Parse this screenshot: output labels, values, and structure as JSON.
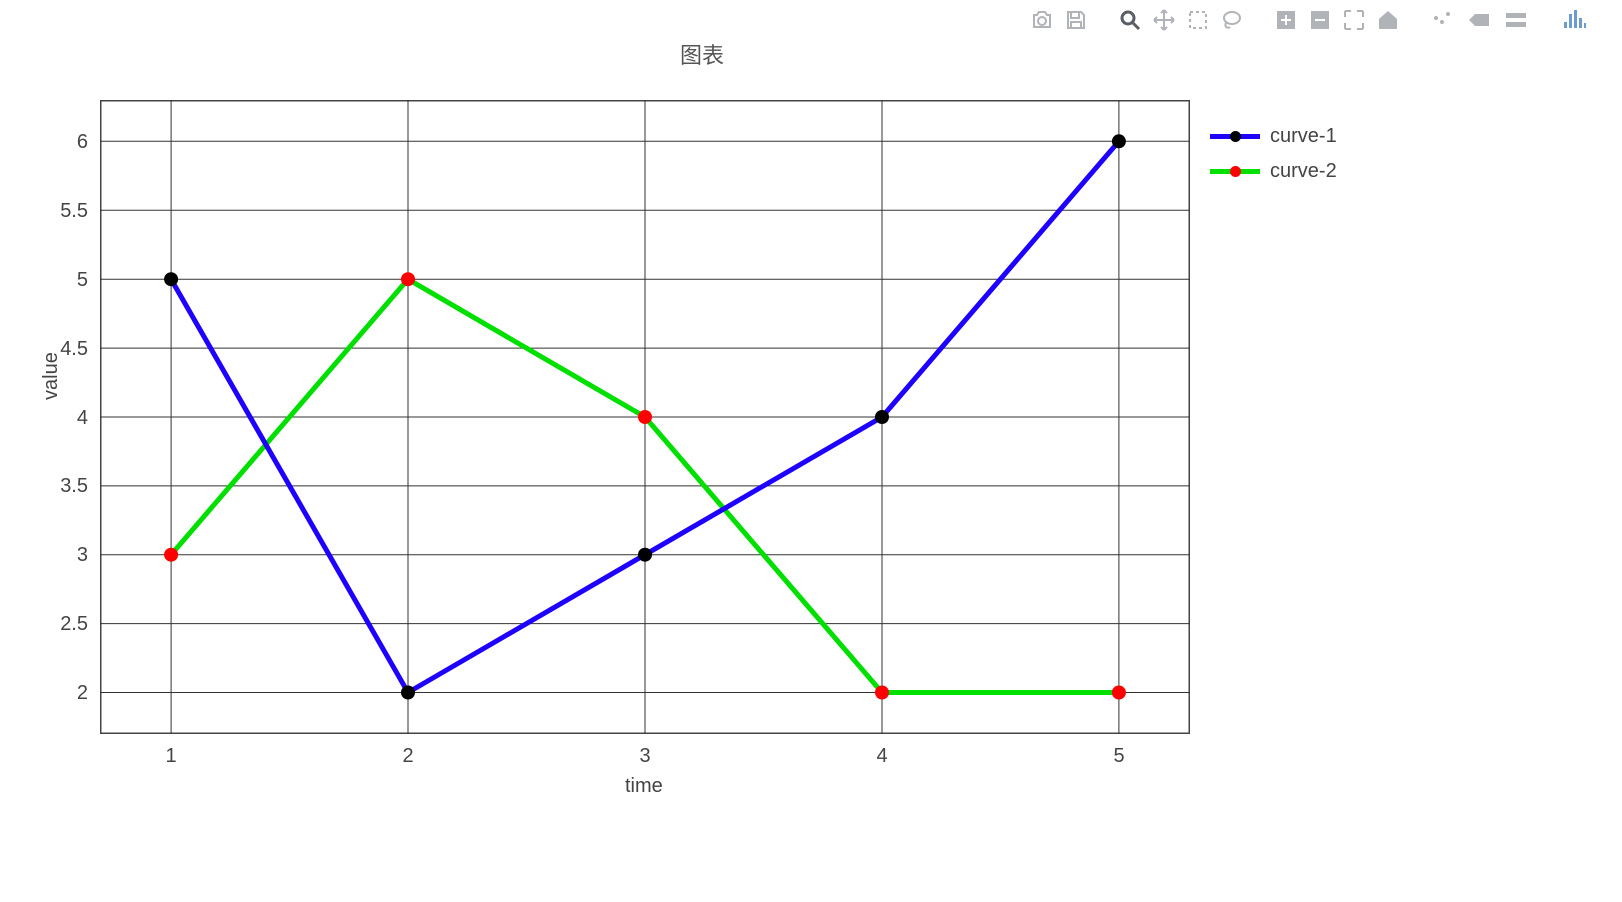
{
  "title": "图表",
  "xlabel": "time",
  "ylabel": "value",
  "legend": {
    "items": [
      {
        "name": "curve-1",
        "color": "#1d00ff",
        "marker": "#000000"
      },
      {
        "name": "curve-2",
        "color": "#00e000",
        "marker": "#ff0000"
      }
    ]
  },
  "x_ticks": [
    "1",
    "2",
    "3",
    "4",
    "5"
  ],
  "y_ticks": [
    "2",
    "2.5",
    "3",
    "3.5",
    "4",
    "4.5",
    "5",
    "5.5",
    "6"
  ],
  "toolbar": {
    "icons": [
      "camera",
      "save",
      "zoom",
      "pan",
      "box-select",
      "lasso",
      "zoom-in",
      "zoom-out",
      "autoscale",
      "home",
      "hover",
      "back",
      "compare",
      "plotly"
    ]
  },
  "chart_data": {
    "type": "line",
    "title": "图表",
    "xlabel": "time",
    "ylabel": "value",
    "xlim": [
      0.7,
      5.3
    ],
    "ylim": [
      1.7,
      6.3
    ],
    "x": [
      1,
      2,
      3,
      4,
      5
    ],
    "series": [
      {
        "name": "curve-1",
        "values": [
          5,
          2,
          3,
          4,
          6
        ],
        "line_color": "#1d00ff",
        "marker_color": "#000000"
      },
      {
        "name": "curve-2",
        "values": [
          3,
          5,
          4,
          2,
          2
        ],
        "line_color": "#00e000",
        "marker_color": "#ff0000"
      }
    ],
    "grid": true
  }
}
